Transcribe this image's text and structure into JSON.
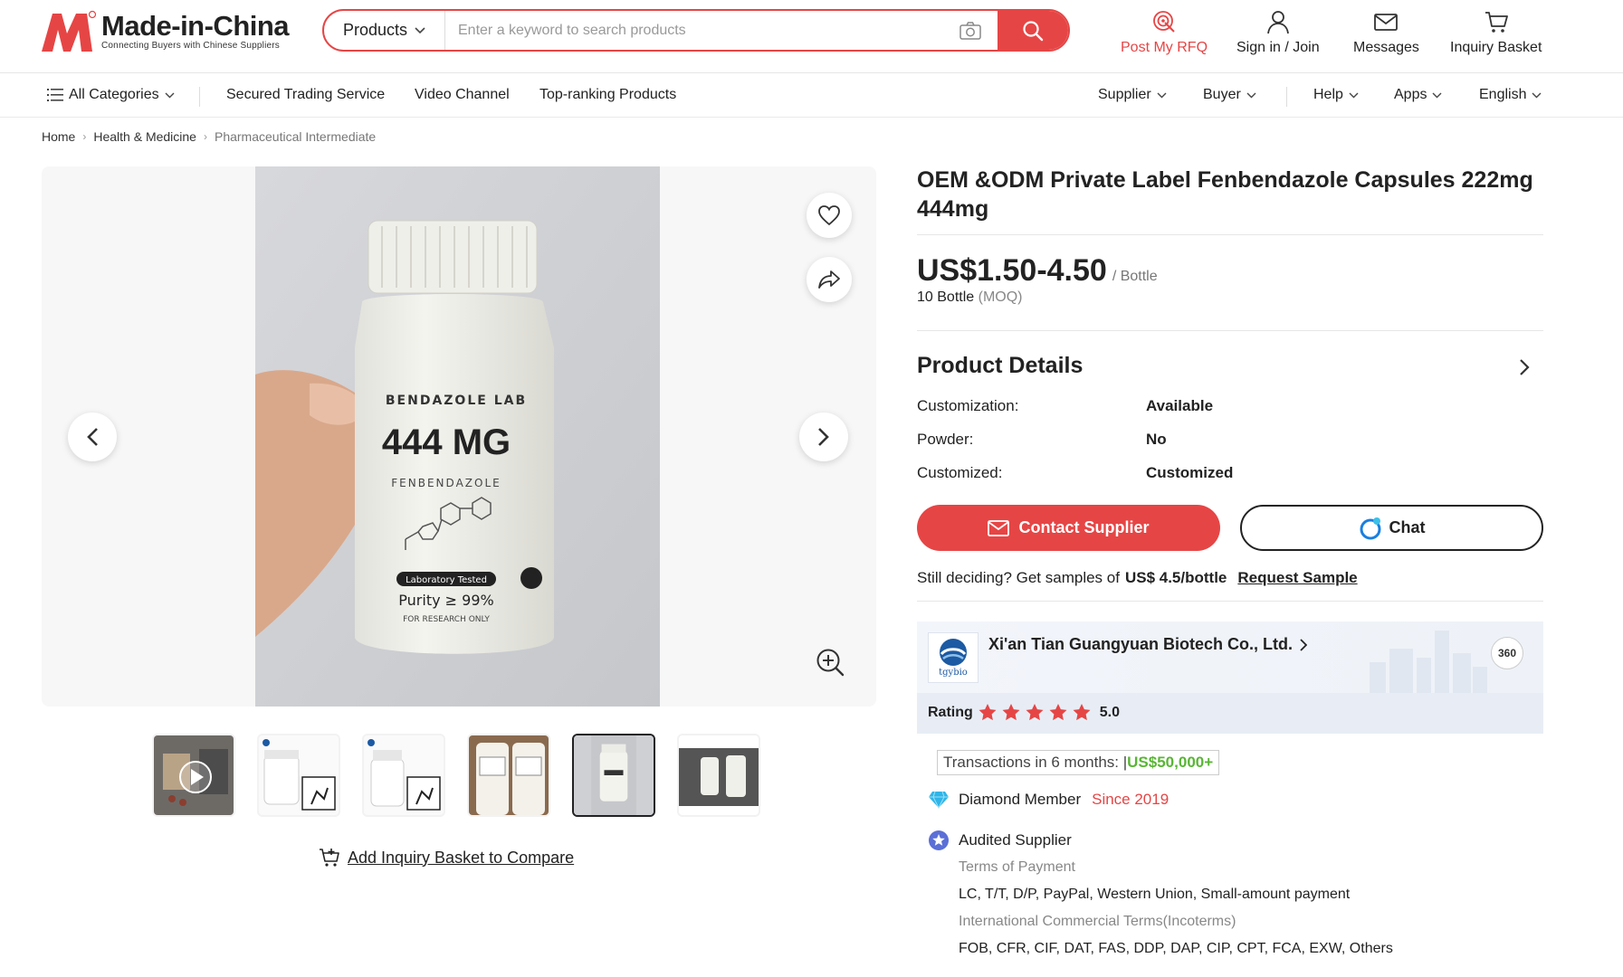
{
  "header": {
    "logo_name": "Made-in-China",
    "logo_tagline": "Connecting Buyers with Chinese Suppliers",
    "search_category": "Products",
    "search_placeholder": "Enter a keyword to search products",
    "links": {
      "rfq": "Post My RFQ",
      "sign_in": "Sign in / Join",
      "messages": "Messages",
      "basket": "Inquiry Basket"
    }
  },
  "nav": {
    "all_categories": "All Categories",
    "items": [
      "Secured Trading Service",
      "Video Channel",
      "Top-ranking Products"
    ],
    "right": [
      "Supplier",
      "Buyer",
      "Help",
      "Apps",
      "English"
    ]
  },
  "breadcrumb": [
    "Home",
    "Health & Medicine",
    "Pharmaceutical Intermediate"
  ],
  "gallery": {
    "bottle_brand": "BENDAZOLE LAB",
    "bottle_dose": "444 MG",
    "bottle_name": "FENBENDAZOLE",
    "bottle_badge": "Laboratory Tested",
    "bottle_purity": "Purity ≥ 99%",
    "bottle_note": "FOR RESEARCH ONLY",
    "compare": "Add Inquiry Basket to Compare"
  },
  "product": {
    "title": "OEM &ODM Private Label Fenbendazole Capsules 222mg 444mg",
    "price": "US$1.50-4.50",
    "price_unit": "/ Bottle",
    "moq_qty": "10 Bottle",
    "moq_label": "(MOQ)",
    "details_title": "Product Details",
    "details": [
      {
        "key": "Customization:",
        "value": "Available"
      },
      {
        "key": "Powder:",
        "value": "No"
      },
      {
        "key": "Customized:",
        "value": "Customized"
      }
    ],
    "contact_button": "Contact Supplier",
    "chat_button": "Chat",
    "sample_text": "Still deciding? Get samples of",
    "sample_price": "US$ 4.5/bottle",
    "sample_link": "Request Sample"
  },
  "supplier": {
    "logo_text": "tgybio",
    "name": "Xi'an Tian Guangyuan Biotech Co., Ltd.",
    "rating_label": "Rating",
    "rating_value": "5.0",
    "rating_stars": 5,
    "transactions_label": "Transactions in 6 months: |",
    "transactions_amount": "US$50,000+",
    "member": "Diamond Member",
    "member_since": "Since 2019",
    "audited": "Audited Supplier",
    "payment_label": "Terms of Payment",
    "payment_value": "LC, T/T, D/P, PayPal, Western Union, Small-amount payment",
    "incoterms_label": "International Commercial Terms(Incoterms)",
    "incoterms_value": "FOB, CFR, CIF, DAT, FAS, DDP, DAP, CIP, CPT, FCA, EXW, Others"
  },
  "colors": {
    "brand_red": "#e64545",
    "green": "#59b535",
    "dark": "#222222"
  }
}
